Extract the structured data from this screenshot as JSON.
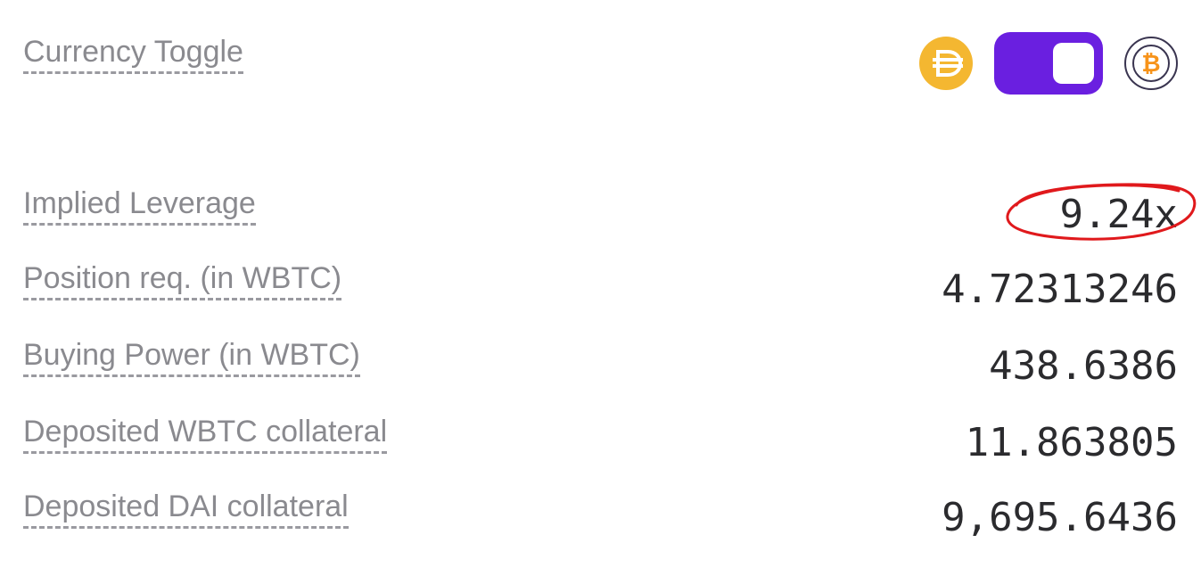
{
  "currency_toggle": {
    "label": "Currency Toggle",
    "left_icon": "dai-icon",
    "right_icon": "btc-icon",
    "state": "btc",
    "accent_color": "#6a1fe0",
    "dai_color": "#f4b731",
    "btc_color": "#f7931a"
  },
  "rows": [
    {
      "label": "Implied Leverage",
      "value": "9.24x"
    },
    {
      "label": "Position req. (in WBTC)",
      "value": "4.72313246"
    },
    {
      "label": "Buying Power (in WBTC)",
      "value": "438.6386"
    },
    {
      "label": "Deposited WBTC collateral",
      "value": "11.863805"
    },
    {
      "label": "Deposited DAI collateral",
      "value": "9,695.6436"
    }
  ],
  "annotation": {
    "color": "#e0191c"
  }
}
